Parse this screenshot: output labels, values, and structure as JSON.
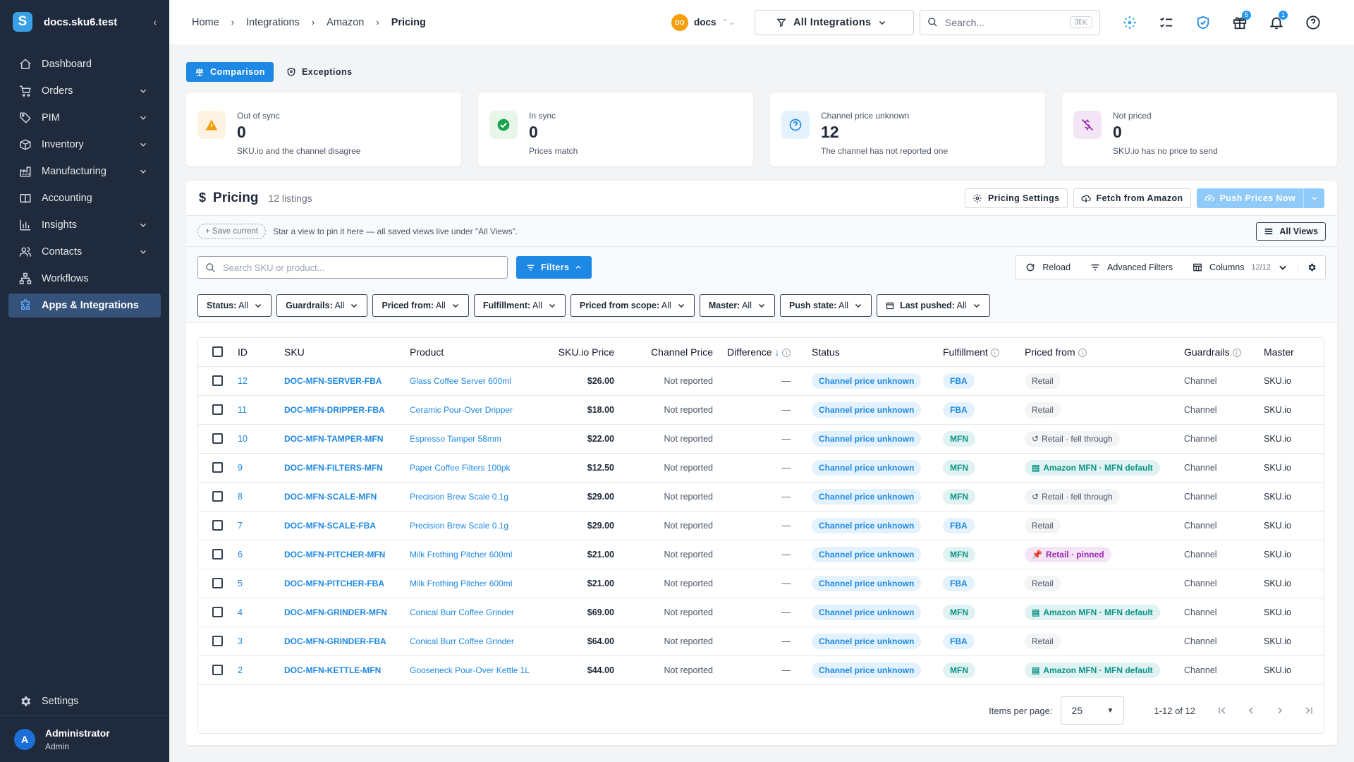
{
  "app": {
    "workspace": "docs.sku6.test",
    "logo_letter": "S"
  },
  "sidebar": {
    "items": [
      {
        "label": "Dashboard",
        "icon": "home-icon",
        "chevron": false
      },
      {
        "label": "Orders",
        "icon": "cart-icon",
        "chevron": true
      },
      {
        "label": "PIM",
        "icon": "tag-icon",
        "chevron": true
      },
      {
        "label": "Inventory",
        "icon": "box-icon",
        "chevron": true
      },
      {
        "label": "Manufacturing",
        "icon": "factory-icon",
        "chevron": true
      },
      {
        "label": "Accounting",
        "icon": "book-icon",
        "chevron": false
      },
      {
        "label": "Insights",
        "icon": "chart-icon",
        "chevron": true
      },
      {
        "label": "Contacts",
        "icon": "users-icon",
        "chevron": true
      },
      {
        "label": "Workflows",
        "icon": "workflow-icon",
        "chevron": false
      },
      {
        "label": "Apps & Integrations",
        "icon": "puzzle-icon",
        "chevron": false,
        "active": true
      }
    ],
    "settings_label": "Settings",
    "user": {
      "initial": "A",
      "name": "Administrator",
      "role": "Admin"
    }
  },
  "topbar": {
    "breadcrumbs": [
      "Home",
      "Integrations",
      "Amazon",
      "Pricing"
    ],
    "org": {
      "initials": "DO",
      "name": "docs"
    },
    "integration_select": "All Integrations",
    "search_placeholder": "Search...",
    "search_shortcut": "⌘K",
    "badges": {
      "gift": "5",
      "bell": "1"
    }
  },
  "tabs": [
    {
      "label": "Comparison",
      "active": true
    },
    {
      "label": "Exceptions",
      "active": false
    }
  ],
  "cards": [
    {
      "title": "Out of sync",
      "value": "0",
      "desc": "SKU.io and the channel disagree",
      "icon": "warning-icon",
      "color": "#f59e0b",
      "bg": "#fef3e2"
    },
    {
      "title": "In sync",
      "value": "0",
      "desc": "Prices match",
      "icon": "check-circle-icon",
      "color": "#16a34a",
      "bg": "#e8f5e9"
    },
    {
      "title": "Channel price unknown",
      "value": "12",
      "desc": "The channel has not reported one",
      "icon": "help-circle-icon",
      "color": "#1e88e5",
      "bg": "#e3f2fd"
    },
    {
      "title": "Not priced",
      "value": "0",
      "desc": "SKU.io has no price to send",
      "icon": "money-off-icon",
      "color": "#9c27b0",
      "bg": "#f3e5f5"
    }
  ],
  "pricing": {
    "title": "Pricing",
    "count": "12 listings",
    "settings_btn": "Pricing Settings",
    "fetch_btn": "Fetch from Amazon",
    "push_btn": "Push Prices Now",
    "save_current": "Save current",
    "views_hint": "Star a view to pin it here — all saved views live under \"All Views\".",
    "all_views": "All Views",
    "search_placeholder": "Search SKU or product...",
    "filters_btn": "Filters",
    "reload": "Reload",
    "advanced_filters": "Advanced Filters",
    "columns": "Columns",
    "columns_count": "12/12"
  },
  "filter_chips": [
    {
      "label": "Status:",
      "value": "All"
    },
    {
      "label": "Guardrails:",
      "value": "All"
    },
    {
      "label": "Priced from:",
      "value": "All"
    },
    {
      "label": "Fulfillment:",
      "value": "All"
    },
    {
      "label": "Priced from scope:",
      "value": "All"
    },
    {
      "label": "Master:",
      "value": "All"
    },
    {
      "label": "Push state:",
      "value": "All"
    },
    {
      "label": "Last pushed:",
      "value": "All",
      "calendar": true
    }
  ],
  "table": {
    "headers": {
      "id": "ID",
      "sku": "SKU",
      "product": "Product",
      "skuio_price": "SKU.io Price",
      "channel_price": "Channel Price",
      "difference": "Difference",
      "status": "Status",
      "fulfillment": "Fulfillment",
      "priced_from": "Priced from",
      "guardrails": "Guardrails",
      "master": "Master"
    },
    "rows": [
      {
        "id": "12",
        "sku": "DOC-MFN-SERVER-FBA",
        "product": "Glass Coffee Server 600ml",
        "price": "$26.00",
        "channel": "Not reported",
        "diff": "—",
        "status": "Channel price unknown",
        "ful": "FBA",
        "from": "Retail",
        "from_type": "retail",
        "guard": "Channel",
        "master": "SKU.io"
      },
      {
        "id": "11",
        "sku": "DOC-MFN-DRIPPER-FBA",
        "product": "Ceramic Pour-Over Dripper",
        "price": "$18.00",
        "channel": "Not reported",
        "diff": "—",
        "status": "Channel price unknown",
        "ful": "FBA",
        "from": "Retail",
        "from_type": "retail",
        "guard": "Channel",
        "master": "SKU.io"
      },
      {
        "id": "10",
        "sku": "DOC-MFN-TAMPER-MFN",
        "product": "Espresso Tamper 58mm",
        "price": "$22.00",
        "channel": "Not reported",
        "diff": "—",
        "status": "Channel price unknown",
        "ful": "MFN",
        "from": "Retail · fell through",
        "from_type": "fell",
        "guard": "Channel",
        "master": "SKU.io"
      },
      {
        "id": "9",
        "sku": "DOC-MFN-FILTERS-MFN",
        "product": "Paper Coffee Filters 100pk",
        "price": "$12.50",
        "channel": "Not reported",
        "diff": "—",
        "status": "Channel price unknown",
        "ful": "MFN",
        "from": "Amazon MFN · MFN default",
        "from_type": "amazon",
        "guard": "Channel",
        "master": "SKU.io"
      },
      {
        "id": "8",
        "sku": "DOC-MFN-SCALE-MFN",
        "product": "Precision Brew Scale 0.1g",
        "price": "$29.00",
        "channel": "Not reported",
        "diff": "—",
        "status": "Channel price unknown",
        "ful": "MFN",
        "from": "Retail · fell through",
        "from_type": "fell",
        "guard": "Channel",
        "master": "SKU.io"
      },
      {
        "id": "7",
        "sku": "DOC-MFN-SCALE-FBA",
        "product": "Precision Brew Scale 0.1g",
        "price": "$29.00",
        "channel": "Not reported",
        "diff": "—",
        "status": "Channel price unknown",
        "ful": "FBA",
        "from": "Retail",
        "from_type": "retail",
        "guard": "Channel",
        "master": "SKU.io"
      },
      {
        "id": "6",
        "sku": "DOC-MFN-PITCHER-MFN",
        "product": "Milk Frothing Pitcher 600ml",
        "price": "$21.00",
        "channel": "Not reported",
        "diff": "—",
        "status": "Channel price unknown",
        "ful": "MFN",
        "from": "Retail · pinned",
        "from_type": "pinned",
        "guard": "Channel",
        "master": "SKU.io"
      },
      {
        "id": "5",
        "sku": "DOC-MFN-PITCHER-FBA",
        "product": "Milk Frothing Pitcher 600ml",
        "price": "$21.00",
        "channel": "Not reported",
        "diff": "—",
        "status": "Channel price unknown",
        "ful": "FBA",
        "from": "Retail",
        "from_type": "retail",
        "guard": "Channel",
        "master": "SKU.io"
      },
      {
        "id": "4",
        "sku": "DOC-MFN-GRINDER-MFN",
        "product": "Conical Burr Coffee Grinder",
        "price": "$69.00",
        "channel": "Not reported",
        "diff": "—",
        "status": "Channel price unknown",
        "ful": "MFN",
        "from": "Amazon MFN · MFN default",
        "from_type": "amazon",
        "guard": "Channel",
        "master": "SKU.io"
      },
      {
        "id": "3",
        "sku": "DOC-MFN-GRINDER-FBA",
        "product": "Conical Burr Coffee Grinder",
        "price": "$64.00",
        "channel": "Not reported",
        "diff": "—",
        "status": "Channel price unknown",
        "ful": "FBA",
        "from": "Retail",
        "from_type": "retail",
        "guard": "Channel",
        "master": "SKU.io"
      },
      {
        "id": "2",
        "sku": "DOC-MFN-KETTLE-MFN",
        "product": "Gooseneck Pour-Over Kettle 1L",
        "price": "$44.00",
        "channel": "Not reported",
        "diff": "—",
        "status": "Channel price unknown",
        "ful": "MFN",
        "from": "Amazon MFN · MFN default",
        "from_type": "amazon",
        "guard": "Channel",
        "master": "SKU.io"
      }
    ]
  },
  "pagination": {
    "items_per_page_label": "Items per page:",
    "per_page": "25",
    "range": "1-12 of 12"
  }
}
